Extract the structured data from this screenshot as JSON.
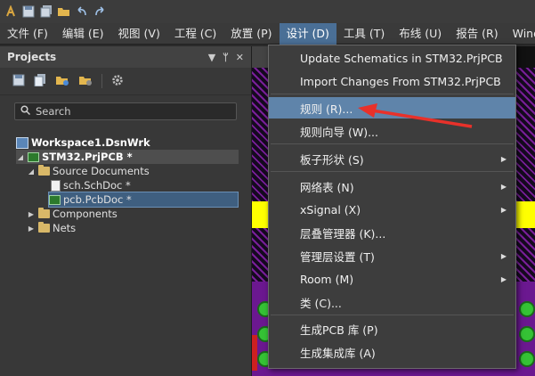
{
  "menubar": {
    "items": [
      "文件 (F)",
      "编辑 (E)",
      "视图 (V)",
      "工程 (C)",
      "放置 (P)",
      "设计 (D)",
      "工具 (T)",
      "布线 (U)",
      "报告 (R)",
      "Window"
    ],
    "active_index": 5
  },
  "toolbar": {
    "icons": [
      "app-icon",
      "save-icon",
      "save-all-icon",
      "open-icon",
      "undo-icon",
      "redo-icon"
    ]
  },
  "panel": {
    "title": "Projects",
    "controls": [
      "▼",
      "ᛘ",
      "✕"
    ],
    "search_placeholder": "Search",
    "tree": {
      "workspace": "Workspace1.DsnWrk",
      "project": "STM32.PrjPCB *",
      "source_documents": "Source Documents",
      "sch_doc": "sch.SchDoc *",
      "pcb_doc": "pcb.PcbDoc *",
      "components": "Components",
      "nets": "Nets"
    }
  },
  "dropdown": {
    "items": [
      {
        "label": "Update Schematics in STM32.PrjPCB",
        "submenu": false
      },
      {
        "label": "Import Changes From STM32.PrjPCB",
        "submenu": false
      },
      {
        "label": "规则 (R)...",
        "submenu": false,
        "highlighted": true
      },
      {
        "label": "规则向导 (W)...",
        "submenu": false
      },
      {
        "label": "板子形状 (S)",
        "submenu": true
      },
      {
        "label": "网络表 (N)",
        "submenu": true
      },
      {
        "label": "xSignal (X)",
        "submenu": true
      },
      {
        "label": "层叠管理器 (K)...",
        "submenu": false
      },
      {
        "label": "管理层设置 (T)",
        "submenu": true
      },
      {
        "label": "Room (M)",
        "submenu": true
      },
      {
        "label": "类 (C)...",
        "submenu": false
      },
      {
        "label": "生成PCB 库 (P)",
        "submenu": false
      },
      {
        "label": "生成集成库 (A)",
        "submenu": false
      }
    ],
    "submenu_arrow": "▶"
  },
  "colors": {
    "menu_active": "#4a6f96",
    "item_highlight": "#5f84aa",
    "annotation_arrow": "#e8312a",
    "pcb_yellow": "#ffff00",
    "pcb_purple": "#8e1fb5",
    "pad_green": "#35c235"
  }
}
